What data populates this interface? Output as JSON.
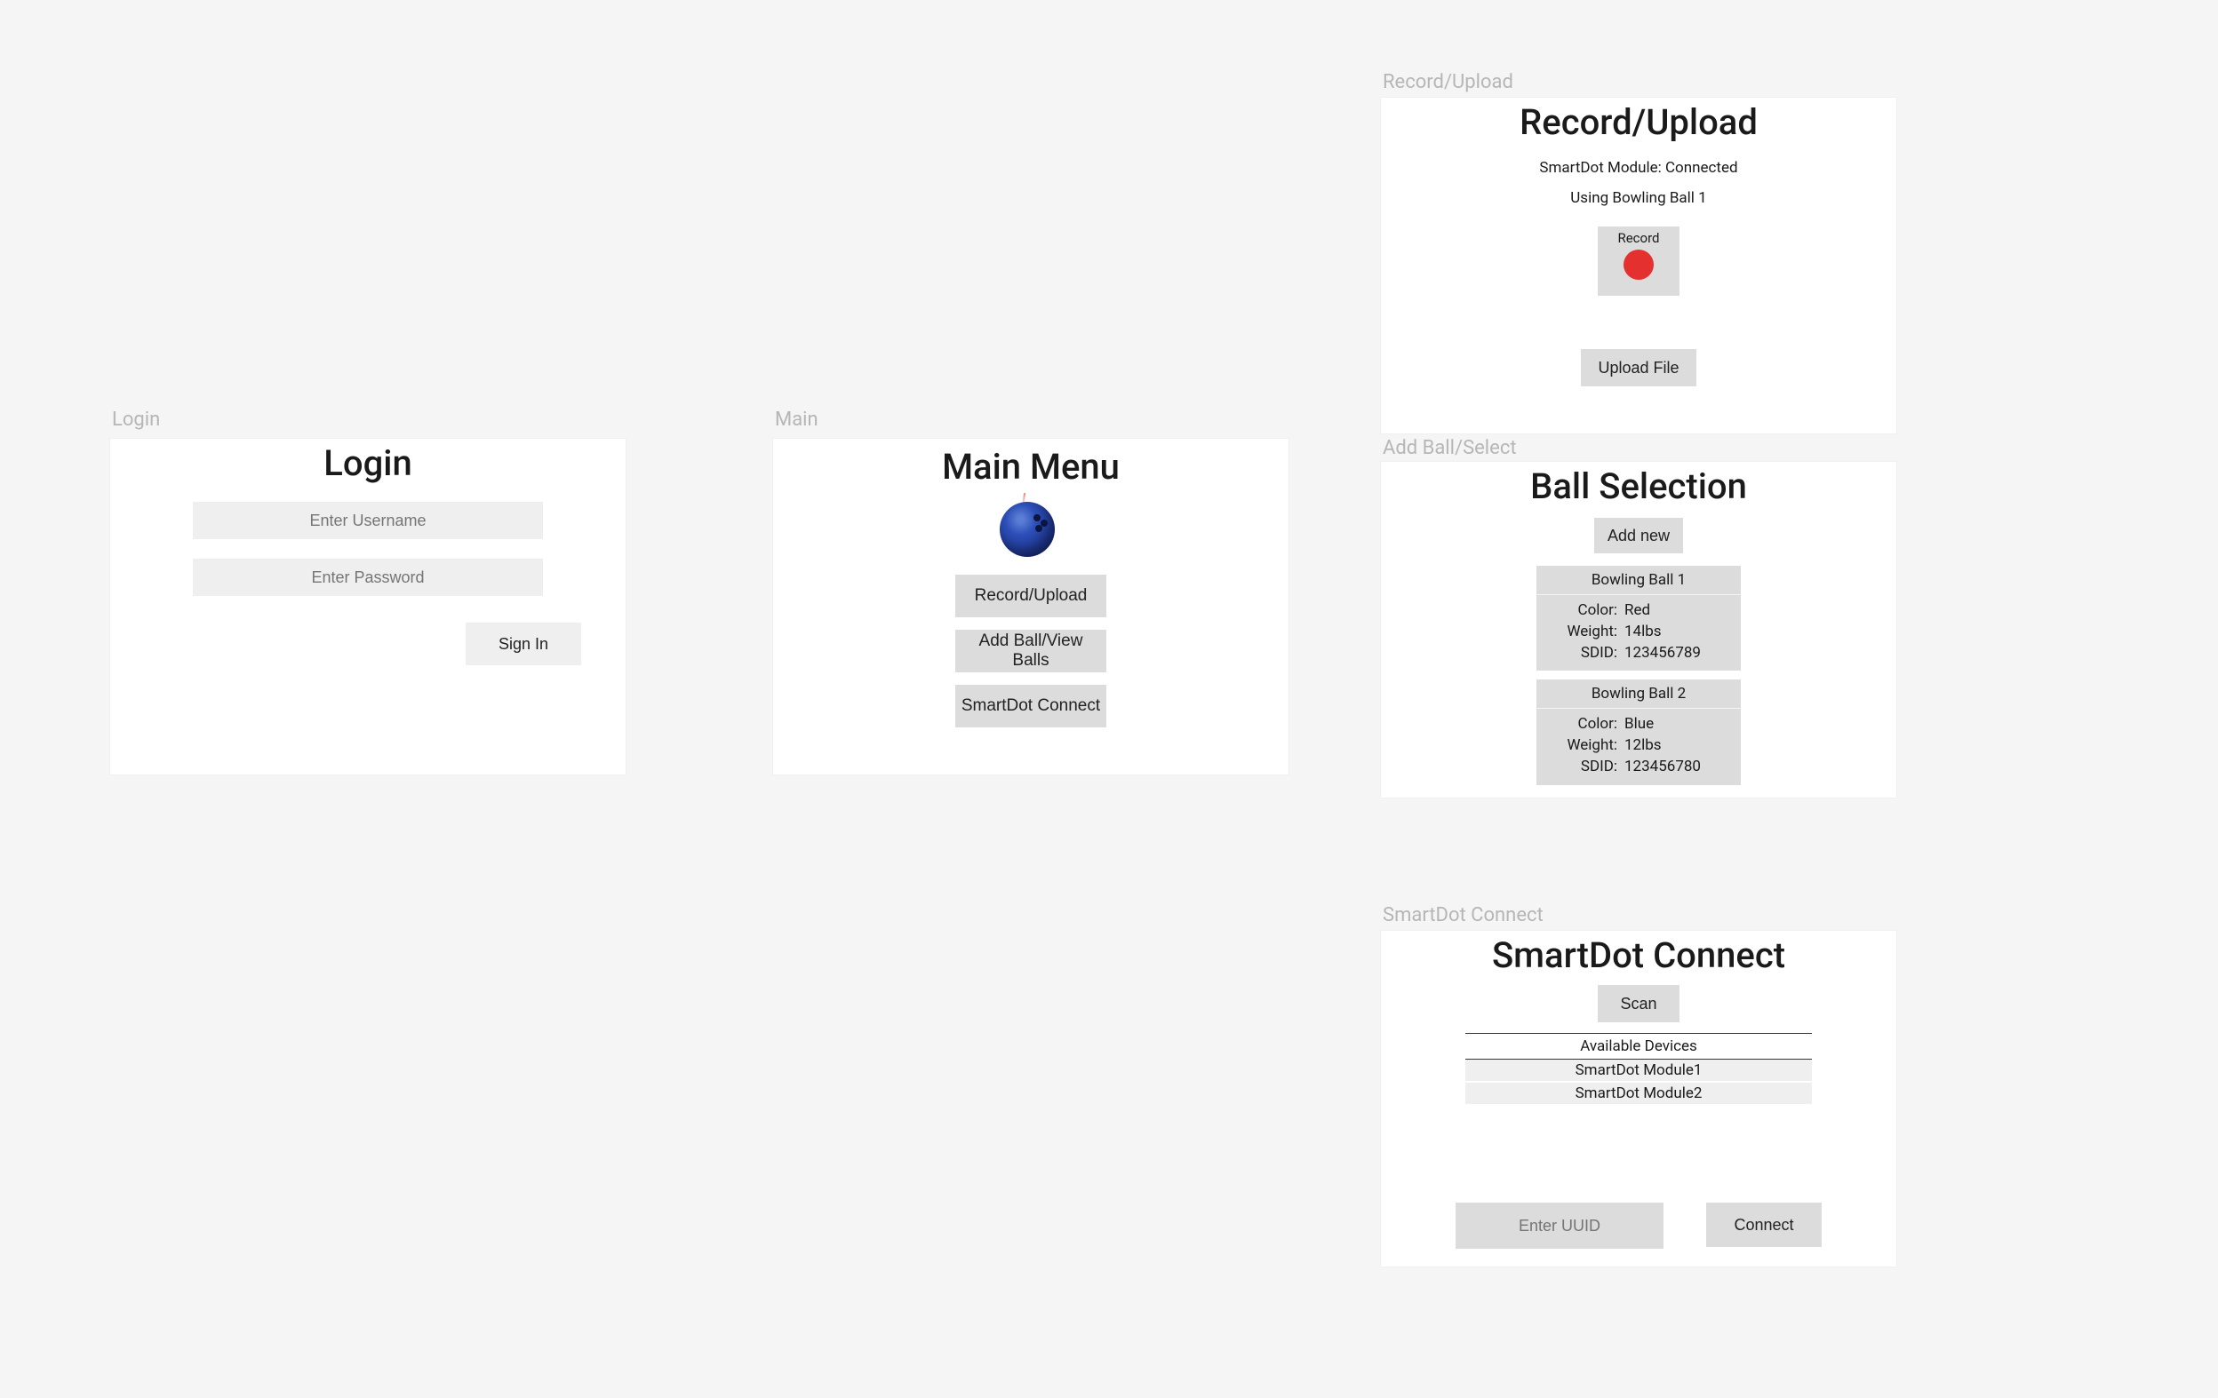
{
  "artboard_labels": {
    "login": "Login",
    "main": "Main",
    "record_upload": "Record/Upload",
    "add_ball": "Add Ball/Select",
    "smartdot_connect": "SmartDot Connect"
  },
  "login": {
    "title": "Login",
    "username_placeholder": "Enter Username",
    "password_placeholder": "Enter Password",
    "signin_label": "Sign In"
  },
  "main": {
    "title": "Main Menu",
    "buttons": {
      "record_upload": "Record/Upload",
      "add_ball": "Add Ball/View Balls",
      "smartdot_connect": "SmartDot Connect"
    }
  },
  "record_upload": {
    "title": "Record/Upload",
    "status": "SmartDot Module: Connected",
    "using": "Using Bowling Ball 1",
    "record_label": "Record",
    "upload_label": "Upload File"
  },
  "ball_selection": {
    "title": "Ball Selection",
    "add_new_label": "Add new",
    "labels": {
      "color": "Color:",
      "weight": "Weight:",
      "sdid": "SDID:"
    },
    "balls": [
      {
        "name": "Bowling Ball 1",
        "color": "Red",
        "weight": "14lbs",
        "sdid": "123456789"
      },
      {
        "name": "Bowling Ball 2",
        "color": "Blue",
        "weight": "12lbs",
        "sdid": "123456780"
      }
    ]
  },
  "smartdot_connect": {
    "title": "SmartDot Connect",
    "scan_label": "Scan",
    "available_header": "Available Devices",
    "devices": [
      "SmartDot Module1",
      "SmartDot Module2"
    ],
    "uuid_placeholder": "Enter UUID",
    "connect_label": "Connect"
  }
}
